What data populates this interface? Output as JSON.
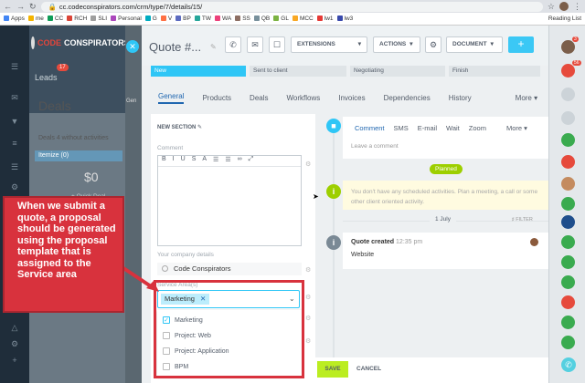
{
  "browser": {
    "url_scheme": "cc.",
    "url": "codeconspirators.com/crm/type/7/details/15/",
    "bookmarks": [
      "Apps",
      "me",
      "CC",
      "RCH",
      "SLI",
      "Personal",
      "G",
      "V",
      "BP",
      "TW",
      "WA",
      "SS",
      "QB",
      "GL",
      "MCC",
      "lw1",
      "lw3"
    ],
    "reading_list": "Reading List"
  },
  "crm": {
    "logo_a": "CODE",
    "logo_b": "CONSPIRATORS",
    "leads_label": "Leads",
    "leads_badge": "17",
    "deals_title": "Deals",
    "deals_sub": "Deals 4 without activities",
    "itemize": "Itemize (0)",
    "amount": "$0",
    "quick_deal": "+ Quick Deal",
    "gen_label": "Gen",
    "cc_label": "CC Sa"
  },
  "header": {
    "title": "Quote #...",
    "extensions": "EXTENSIONS",
    "actions": "ACTIONS",
    "document": "DOCUMENT",
    "plus": "+"
  },
  "stages": [
    "New",
    "Sent to client",
    "Negotiating",
    "Finish"
  ],
  "tabs": [
    "General",
    "Products",
    "Deals",
    "Workflows",
    "Invoices",
    "Dependencies",
    "History",
    "More"
  ],
  "form": {
    "section": "NEW SECTION",
    "comment_label": "Comment",
    "toolbar": [
      "B",
      "I",
      "U",
      "S",
      "A",
      "☰",
      "☰",
      "∞",
      "⤢"
    ],
    "company_label": "Your company details",
    "company_value": "Code Conspirators",
    "service_label": "Service Area(s)",
    "selected_tag": "Marketing",
    "options": [
      {
        "label": "Marketing",
        "checked": true
      },
      {
        "label": "Project: Web",
        "checked": false
      },
      {
        "label": "Project: Application",
        "checked": false
      },
      {
        "label": "BPM",
        "checked": false
      }
    ]
  },
  "callout": "When we submit a quote, a proposal should be generated using the proposal template that is assigned to the Service area",
  "timeline": {
    "tabs": [
      "Comment",
      "SMS",
      "E-mail",
      "Wait",
      "Zoom",
      "More"
    ],
    "leave_comment": "Leave a comment",
    "planned": "Planned",
    "no_activities": "You don't have any scheduled activities. Plan a meeting, a call or some other client oriented activity.",
    "date": "1 July",
    "filter": "FILTER",
    "entry_title": "Quote created",
    "entry_time": "12:35 pm",
    "entry_text": "Website"
  },
  "footer": {
    "save": "SAVE",
    "cancel": "CANCEL"
  },
  "right_badges": [
    "3",
    "56"
  ]
}
